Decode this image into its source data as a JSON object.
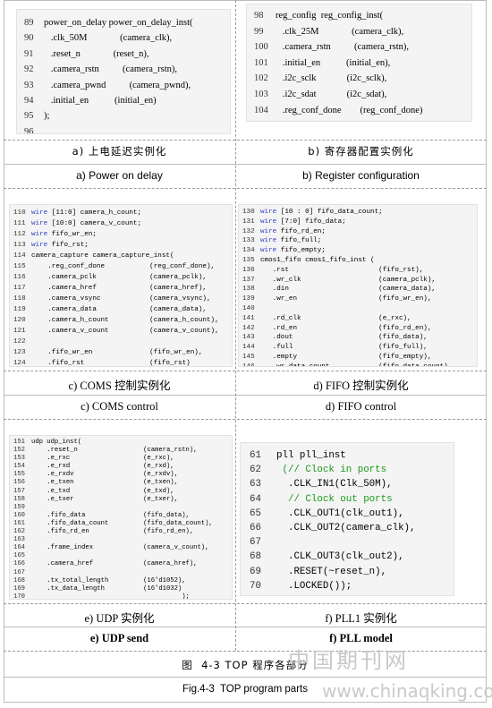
{
  "panels": {
    "a": {
      "lines": [
        {
          "n": "89",
          "t": "power_on_delay power_on_delay_inst("
        },
        {
          "n": "90",
          "t": "   .clk_50M              (camera_clk),"
        },
        {
          "n": "91",
          "t": "   .reset_n              (reset_n),"
        },
        {
          "n": "92",
          "t": "   .camera_rstn          (camera_rstn),"
        },
        {
          "n": "93",
          "t": "   .camera_pwnd          (camera_pwnd),"
        },
        {
          "n": "94",
          "t": "   .initial_en           (initial_en)"
        },
        {
          "n": "95",
          "t": ");"
        },
        {
          "n": "96",
          "t": ""
        }
      ],
      "caption_zh": "a) 上电延迟实例化",
      "caption_en": "a) Power on delay"
    },
    "b": {
      "lines": [
        {
          "n": "98",
          "t": "reg_config  reg_config_inst("
        },
        {
          "n": "99",
          "t": "   .clk_25M              (camera_clk),"
        },
        {
          "n": "100",
          "t": "   .camera_rstn          (camera_rstn),"
        },
        {
          "n": "101",
          "t": "   .initial_en           (initial_en),"
        },
        {
          "n": "102",
          "t": "   .i2c_sclk             (i2c_sclk),"
        },
        {
          "n": "103",
          "t": "   .i2c_sdat             (i2c_sdat),"
        },
        {
          "n": "104",
          "t": "   .reg_conf_done        (reg_conf_done)"
        }
      ],
      "caption_zh": "b) 寄存器配置实例化",
      "caption_en": "b) Register configuration"
    },
    "c": {
      "lines": [
        {
          "n": "110",
          "k": "wire",
          "t": " [11:0] camera_h_count;"
        },
        {
          "n": "111",
          "k": "wire",
          "t": " [10:0] camera_v_count;"
        },
        {
          "n": "112",
          "k": "wire",
          "t": " fifo_wr_en;"
        },
        {
          "n": "113",
          "k": "wire",
          "t": " fifo_rst;"
        },
        {
          "n": "114",
          "t": "camera_capture camera_capture_inst("
        },
        {
          "n": "115",
          "t": "    .reg_conf_done           (reg_conf_done),"
        },
        {
          "n": "116",
          "t": "    .camera_pclk             (camera_pclk),"
        },
        {
          "n": "117",
          "t": "    .camera_href             (camera_href),"
        },
        {
          "n": "118",
          "t": "    .camera_vsync            (camera_vsync),"
        },
        {
          "n": "119",
          "t": "    .camera_data             (camera_data),"
        },
        {
          "n": "120",
          "t": "    .camera_h_count          (camera_h_count),"
        },
        {
          "n": "121",
          "t": "    .camera_v_count          (camera_v_count),"
        },
        {
          "n": "122",
          "t": ""
        },
        {
          "n": "123",
          "t": "    .fifo_wr_en              (fifo_wr_en),"
        },
        {
          "n": "124",
          "t": "    .fifo_rst                (fifo_rst)"
        }
      ],
      "caption_zh": "c) COMS 控制实例化",
      "caption_en": "c) COMS control"
    },
    "d": {
      "lines": [
        {
          "n": "130",
          "k": "wire",
          "t": " [10 : 0] fifo_data_count;"
        },
        {
          "n": "131",
          "k": "wire",
          "t": " [7:0] fifo_data;"
        },
        {
          "n": "132",
          "k": "wire",
          "t": " fifo_rd_en;"
        },
        {
          "n": "133",
          "k": "wire",
          "t": " fifo_full;"
        },
        {
          "n": "134",
          "k": "wire",
          "t": " fifo_empty;"
        },
        {
          "n": "135",
          "t": "cmos1_fifo cmos1_fifo_inst ("
        },
        {
          "n": "136",
          "t": "   .rst                      (fifo_rst),"
        },
        {
          "n": "137",
          "t": "   .wr_clk                   (camera_pclk),"
        },
        {
          "n": "138",
          "t": "   .din                      (camera_data),"
        },
        {
          "n": "139",
          "t": "   .wr_en                    (fifo_wr_en),"
        },
        {
          "n": "140",
          "t": ""
        },
        {
          "n": "141",
          "t": "   .rd_clk                   (e_rxc),"
        },
        {
          "n": "142",
          "t": "   .rd_en                    (fifo_rd_en),"
        },
        {
          "n": "143",
          "t": "   .dout                     (fifo_data),"
        },
        {
          "n": "144",
          "t": "   .full                     (fifo_full),"
        },
        {
          "n": "145",
          "t": "   .empty                    (fifo_empty),"
        },
        {
          "n": "146",
          "t": "   .wr_data_count            (fifo_data_count)"
        }
      ],
      "caption_zh": "d) FIFO 控制实例化",
      "caption_en": "d) FIFO control"
    },
    "e": {
      "lines": [
        {
          "n": "151",
          "t": "udp udp_inst("
        },
        {
          "n": "152",
          "t": "    .reset_n                 (camera_rstn),"
        },
        {
          "n": "153",
          "t": "    .e_rxc                   (e_rxc),"
        },
        {
          "n": "154",
          "t": "    .e_rxd                   (e_rxd),"
        },
        {
          "n": "155",
          "t": "    .e_rxdv                  (e_rxdv),"
        },
        {
          "n": "156",
          "t": "    .e_txen                  (e_txen),"
        },
        {
          "n": "157",
          "t": "    .e_txd                   (e_txd),"
        },
        {
          "n": "158",
          "t": "    .e_txer                  (e_txer),"
        },
        {
          "n": "159",
          "t": ""
        },
        {
          "n": "160",
          "t": "    .fifo_data               (fifo_data),"
        },
        {
          "n": "161",
          "t": "    .fifo_data_count         (fifo_data_count),"
        },
        {
          "n": "162",
          "t": "    .fifo_rd_en              (fifo_rd_en),"
        },
        {
          "n": "163",
          "t": ""
        },
        {
          "n": "164",
          "t": "    .frame_index             (camera_v_count),"
        },
        {
          "n": "165",
          "t": ""
        },
        {
          "n": "166",
          "t": "    .camera_href             (camera_href),"
        },
        {
          "n": "167",
          "t": ""
        },
        {
          "n": "168",
          "t": "    .tx_total_length         (16'd1052),"
        },
        {
          "n": "169",
          "t": "    .tx_data_length          (16'd1032)"
        },
        {
          "n": "170",
          "t": "                                       );"
        }
      ],
      "caption_zh": "e) UDP 实例化",
      "caption_en": "e) UDP send"
    },
    "f": {
      "lines": [
        {
          "n": "61",
          "t": "pll pll_inst"
        },
        {
          "n": "62",
          "c": " (// Clock in ports"
        },
        {
          "n": "63",
          "t": "  .CLK_IN1(Clk_50M),"
        },
        {
          "n": "64",
          "c": "  // Clock out ports"
        },
        {
          "n": "65",
          "t": "  .CLK_OUT1(clk_out1),"
        },
        {
          "n": "66",
          "t": "  .CLK_OUT2(camera_clk),"
        },
        {
          "n": "67",
          "t": ""
        },
        {
          "n": "68",
          "t": "  .CLK_OUT3(clk_out2),"
        },
        {
          "n": "69",
          "t": "  .RESET(~reset_n),"
        },
        {
          "n": "70",
          "t": "  .LOCKED());"
        }
      ],
      "caption_zh": "f) PLL1 实例化",
      "caption_en": "f) PLL model"
    }
  },
  "figure": {
    "caption_zh": "图  4-3 TOP 程序各部分",
    "caption_en": "Fig.4-3  TOP program parts"
  },
  "watermark": {
    "cn": "中国期刊网",
    "url": "www.chinaqking.com"
  }
}
